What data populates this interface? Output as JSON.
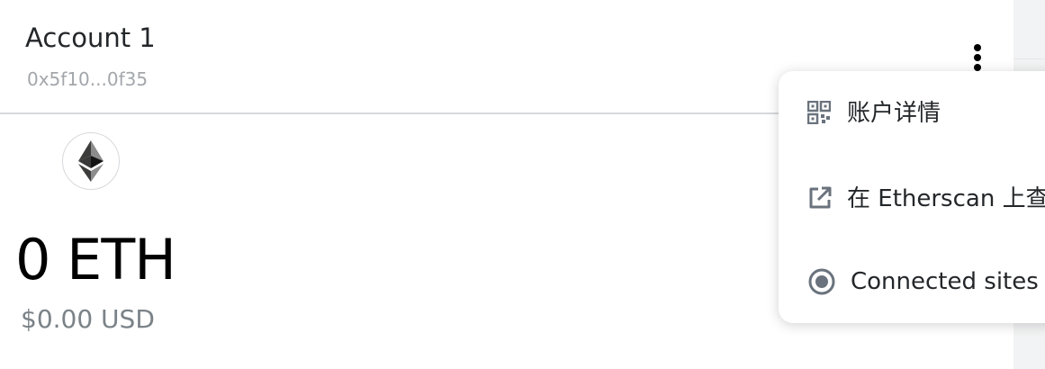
{
  "account": {
    "name": "Account 1",
    "address": "0x5f10...0f35"
  },
  "balance": {
    "amount": "0 ETH",
    "fiat": "$0.00 USD"
  },
  "menu": {
    "items": [
      {
        "label": "账户详情",
        "icon": "qr-code-icon"
      },
      {
        "label": "在 Etherscan 上查",
        "icon": "external-link-icon"
      },
      {
        "label": "Connected sites",
        "icon": "connected-sites-icon"
      }
    ]
  },
  "colors": {
    "text_primary": "#24272a",
    "text_muted": "#a3a7ab",
    "fiat_text": "#7b8388",
    "icon_gray": "#6a737d",
    "divider": "#d6d9dc"
  }
}
